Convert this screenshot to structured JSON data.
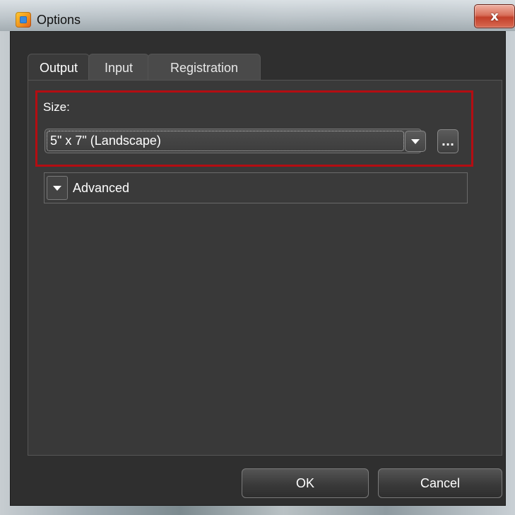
{
  "window": {
    "title": "Options",
    "close_label": "x"
  },
  "tabs": [
    {
      "label": "Output",
      "active": true
    },
    {
      "label": "Input",
      "active": false
    },
    {
      "label": "Registration",
      "active": false
    }
  ],
  "output": {
    "size_label": "Size:",
    "size_value": "5\" x 7\" (Landscape)",
    "browse_label": "...",
    "advanced_label": "Advanced"
  },
  "buttons": {
    "ok_label": "OK",
    "cancel_label": "Cancel"
  },
  "colors": {
    "highlight": "#b40d12",
    "dialog_bg": "#2f2f2f"
  },
  "icons": {
    "app": "app-icon",
    "dropdown": "chevron-down-icon",
    "advanced_toggle": "chevron-down-icon"
  }
}
